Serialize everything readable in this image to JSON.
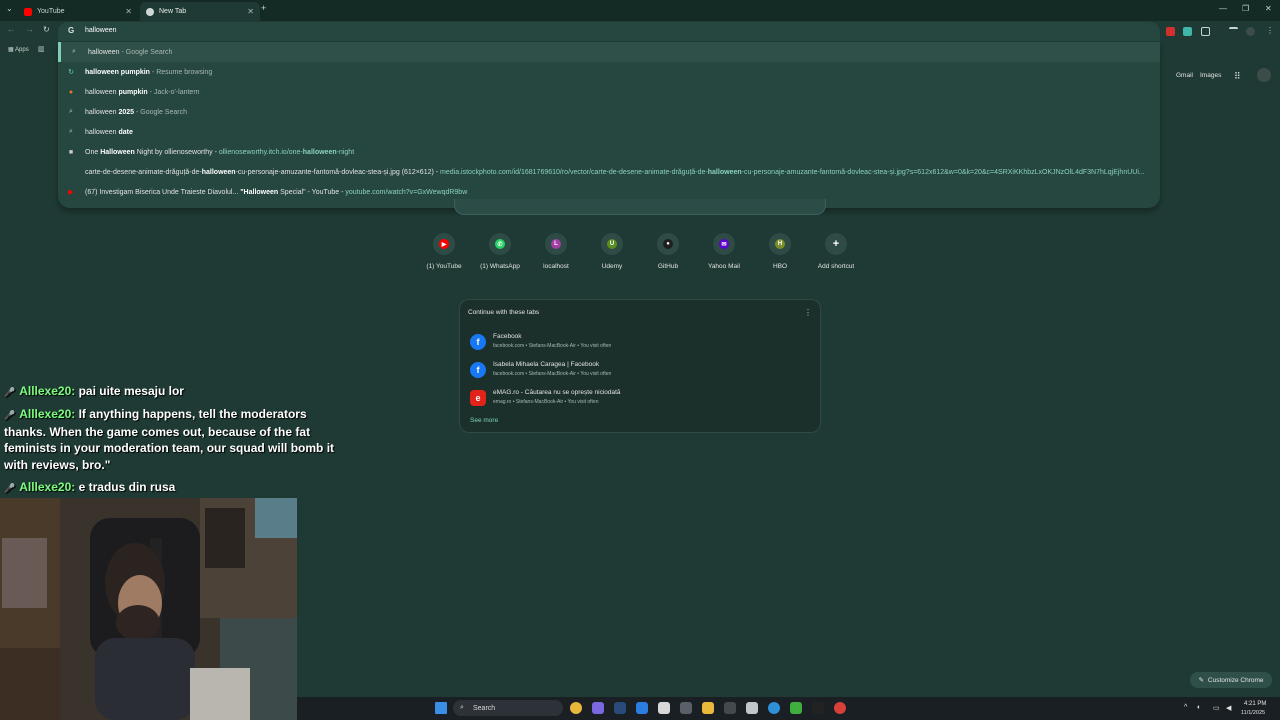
{
  "tabs": [
    {
      "title": "YouTube",
      "favicon_color": "#ff0000"
    },
    {
      "title": "New Tab",
      "favicon_color": "#cfd8d5"
    }
  ],
  "omnibox": {
    "value": "halloween",
    "g_icon": "G"
  },
  "bookmarks": {
    "apps_label": "Apps"
  },
  "suggestions": [
    {
      "icon": "search-icon",
      "parts": [
        {
          "t": "halloween",
          "s": "n"
        },
        {
          "t": " - Google Search",
          "s": "dim"
        }
      ]
    },
    {
      "icon": "resume-icon",
      "parts": [
        {
          "t": "halloween ",
          "s": "b"
        },
        {
          "t": "pumpkin",
          "s": "b"
        },
        {
          "t": " - Resume browsing",
          "s": "dim"
        }
      ]
    },
    {
      "icon": "pumpkin-image-icon",
      "parts": [
        {
          "t": "halloween ",
          "s": "n"
        },
        {
          "t": "pumpkin",
          "s": "b"
        },
        {
          "t": " - Jack-o'-lantern",
          "s": "dim"
        }
      ]
    },
    {
      "icon": "search-icon",
      "parts": [
        {
          "t": "halloween ",
          "s": "n"
        },
        {
          "t": "2025",
          "s": "b"
        },
        {
          "t": " - Google Search",
          "s": "dim"
        }
      ]
    },
    {
      "icon": "search-icon",
      "parts": [
        {
          "t": "halloween ",
          "s": "n"
        },
        {
          "t": "date",
          "s": "b"
        }
      ]
    },
    {
      "icon": "page-icon",
      "parts": [
        {
          "t": "One ",
          "s": "n"
        },
        {
          "t": "Halloween",
          "s": "b"
        },
        {
          "t": " Night by ollienoseworthy - ",
          "s": "n"
        },
        {
          "t": "ollienoseworthy.itch.io/one-",
          "s": "link"
        },
        {
          "t": "halloween",
          "s": "linkb"
        },
        {
          "t": "-night",
          "s": "link"
        }
      ]
    },
    {
      "icon": "none",
      "parts": [
        {
          "t": "carte-de-desene-animate-drăguță-de-",
          "s": "n"
        },
        {
          "t": "halloween",
          "s": "b"
        },
        {
          "t": "-cu-personaje-amuzante-fantomă-dovleac-stea-și.jpg (612×612) - ",
          "s": "n"
        },
        {
          "t": "media.istockphoto.com/id/1681769610/ro/vector/carte-de-desene-animate-drăguță-de-",
          "s": "link"
        },
        {
          "t": "halloween",
          "s": "linkb"
        },
        {
          "t": "-cu-personaje-amuzante-fantomă-dovleac-stea-și.jpg?s=612x612&w=0&k=20&c=4SRXiKKhbzLxOKJNzOlL4dF3N7hLqjEjhnUUi...",
          "s": "link"
        }
      ]
    },
    {
      "icon": "youtube-icon",
      "parts": [
        {
          "t": "(67) Investigam Biserica Unde Traieste Diavolul... ",
          "s": "n"
        },
        {
          "t": "\"Halloween",
          "s": "b"
        },
        {
          "t": " Special\" - YouTube - ",
          "s": "n"
        },
        {
          "t": "youtube.com/watch?v=GxWewqdR9bw",
          "s": "link"
        }
      ]
    }
  ],
  "top_links": {
    "gmail": "Gmail",
    "images": "Images"
  },
  "shortcuts": [
    {
      "label": "(1) YouTube",
      "glyph": "▶",
      "color": "#ff0000"
    },
    {
      "label": "(1) WhatsApp",
      "glyph": "✆",
      "color": "#25d366"
    },
    {
      "label": "localhost",
      "glyph": "L",
      "color": "#a23fa6"
    },
    {
      "label": "Udemy",
      "glyph": "U",
      "color": "#5a8f1f"
    },
    {
      "label": "GitHub",
      "glyph": "●",
      "color": "#1f1f1f"
    },
    {
      "label": "Yahoo Mail",
      "glyph": "✉",
      "color": "#5f01d1"
    },
    {
      "label": "HBO",
      "glyph": "H",
      "color": "#7a8f2a"
    },
    {
      "label": "Add shortcut",
      "glyph": "+",
      "color": "#2e4b45"
    }
  ],
  "continue_card": {
    "title": "Continue with these tabs",
    "items": [
      {
        "title": "Facebook",
        "meta": "facebook.com • Stefans-MacBook-Air • You visit often",
        "icon": "f",
        "color": "#1877f2"
      },
      {
        "title": "Isabela Mihaela Caragea | Facebook",
        "meta": "facebook.com • Stefans-MacBook-Air • You visit often",
        "icon": "f",
        "color": "#1877f2"
      },
      {
        "title": "eMAG.ro - Căutarea nu se oprește niciodată",
        "meta": "emag.ro • Stefans-MacBook-Air • You visit often",
        "icon": "e",
        "color": "#e2231a"
      }
    ],
    "see_more": "See more"
  },
  "chat": [
    {
      "badge": "🎤",
      "user": "Alllexe20:",
      "text": " pai uite mesaju lor"
    },
    {
      "badge": "🎤",
      "user": "Alllexe20:",
      "text": " If anything happens, tell the moderators thanks. When the game comes out, because of the fat feminists in your moderation team, our squad will bomb it with reviews, bro.\""
    },
    {
      "badge": "🎤",
      "user": "Alllexe20:",
      "text": " e tradus din rusa"
    }
  ],
  "customize": "Customize Chrome",
  "taskbar": {
    "search_placeholder": "Search",
    "time": "4:21 PM",
    "date": "11/1/2025"
  }
}
